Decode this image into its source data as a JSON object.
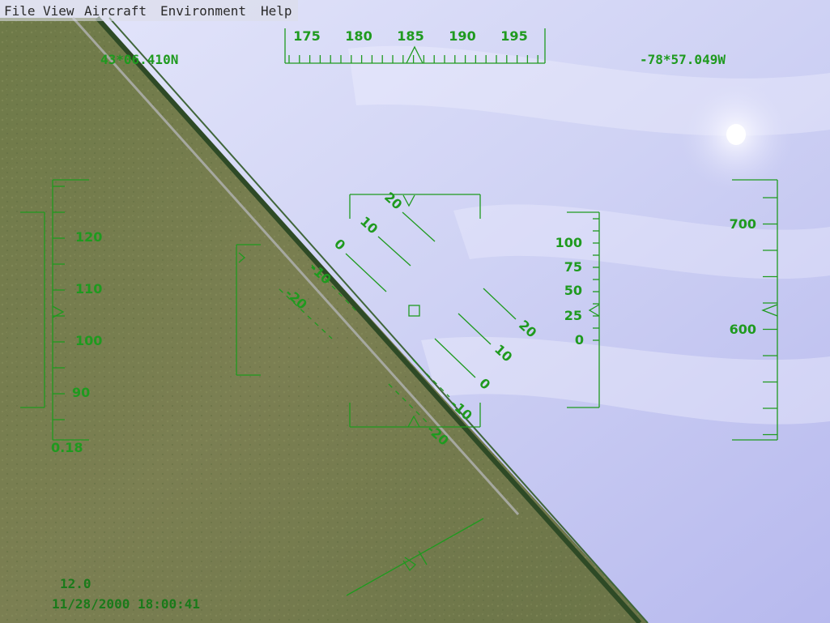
{
  "menu": [
    "File",
    "View",
    "Aircraft",
    "Environment",
    "Help"
  ],
  "hud": {
    "latitude": "43*06.410N",
    "longitude": "-78*57.049W",
    "heading_ticks": [
      "175",
      "180",
      "185",
      "190",
      "195"
    ],
    "speed_ticks": [
      "120",
      "110",
      "100",
      "90"
    ],
    "speed_footer": "0.18",
    "altitude_ticks": [
      "700",
      "600"
    ],
    "vsi_ticks": [
      "100",
      "75",
      "50",
      "25",
      "0"
    ],
    "pitch_labels_left": [
      "20",
      "10",
      "0",
      "-10",
      "-20"
    ],
    "pitch_labels_right": [
      "20",
      "10",
      "0",
      "-10",
      "-20"
    ],
    "readout": "12.0",
    "timestamp": "11/28/2000 18:00:41",
    "color": "#1f9a1f"
  }
}
